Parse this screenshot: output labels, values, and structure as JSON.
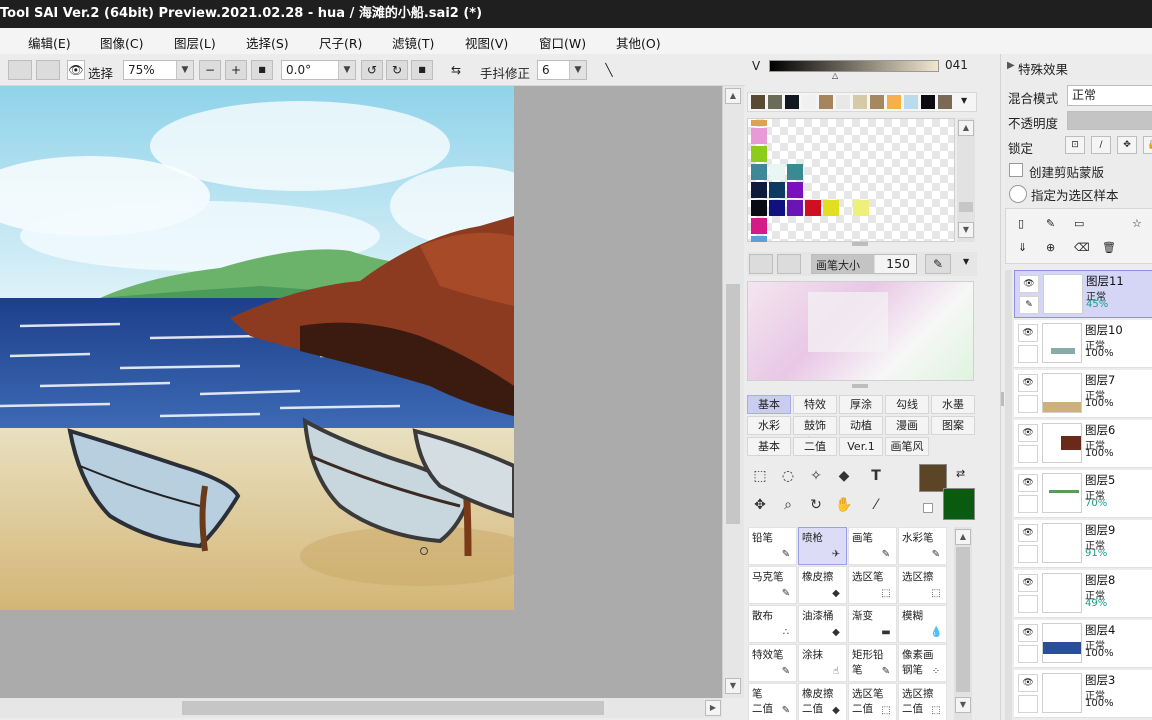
{
  "window": {
    "title": "Tool SAI Ver.2 (64bit) Preview.2021.02.28 - hua / 海滩的小船.sai2 (*)"
  },
  "menu": [
    "编辑(E)",
    "图像(C)",
    "图层(L)",
    "选择(S)",
    "尺子(R)",
    "滤镜(T)",
    "视图(V)",
    "窗口(W)",
    "其他(O)"
  ],
  "toolbar": {
    "select_label": "选择",
    "zoom_value": "75%",
    "minus": "−",
    "plus": "+",
    "reset": "■",
    "angle_value": "0.0°",
    "stabilizer_label": "手抖修正",
    "stabilizer_value": "6"
  },
  "color": {
    "v_label": "V",
    "v_value": "041",
    "palette_top": [
      "#5a4a32",
      "#6b6b5a",
      "#121820",
      "#f0f0f0",
      "#a6845c",
      "#e8e8e8",
      "#d6c9a8",
      "#a68860",
      "#f5b04a",
      "#b8dcea",
      "#0c0c10",
      "#7a6a55"
    ],
    "primary": "#5c4526",
    "secondary": "#0a5a10"
  },
  "brush": {
    "size_label": "画笔大小",
    "size_value": "150"
  },
  "tool_tabs": [
    [
      "基本",
      "特效",
      "厚涂",
      "勾线",
      "水墨"
    ],
    [
      "水彩",
      "鼓饰布...",
      "动植飞...",
      "漫画风...",
      "图案"
    ],
    [
      "基本",
      "二值",
      "Ver.1",
      "画笔风"
    ]
  ],
  "brushes": [
    {
      "name": "铅笔",
      "sub": ""
    },
    {
      "name": "喷枪",
      "sub": ""
    },
    {
      "name": "画笔",
      "sub": ""
    },
    {
      "name": "水彩笔",
      "sub": ""
    },
    {
      "name": "马克笔",
      "sub": ""
    },
    {
      "name": "橡皮擦",
      "sub": ""
    },
    {
      "name": "选区笔",
      "sub": ""
    },
    {
      "name": "选区擦",
      "sub": ""
    },
    {
      "name": "散布",
      "sub": ""
    },
    {
      "name": "油漆桶",
      "sub": ""
    },
    {
      "name": "渐变",
      "sub": ""
    },
    {
      "name": "模糊",
      "sub": ""
    },
    {
      "name": "特效笔",
      "sub": ""
    },
    {
      "name": "涂抹",
      "sub": ""
    },
    {
      "name": "矩形铅笔",
      "sub": ""
    },
    {
      "name": "像素画",
      "sub": "钢笔"
    },
    {
      "name": "笔",
      "sub": "二值"
    },
    {
      "name": "橡皮擦",
      "sub": "二值"
    },
    {
      "name": "选区笔",
      "sub": "二值"
    },
    {
      "name": "选区擦",
      "sub": "二值"
    }
  ],
  "layer_props": {
    "effects_label": "特殊效果",
    "blend_label": "混合模式",
    "blend_value": "正常",
    "opacity_label": "不透明度",
    "lock_label": "锁定",
    "clip_label": "创建剪贴蒙版",
    "sample_label": "指定为选区样本"
  },
  "layers": [
    {
      "name": "图层11",
      "mode": "正常",
      "opacity": "45%",
      "teal": true
    },
    {
      "name": "图层10",
      "mode": "正常",
      "opacity": "100%",
      "teal": false
    },
    {
      "name": "图层7",
      "mode": "正常",
      "opacity": "100%",
      "teal": false
    },
    {
      "name": "图层6",
      "mode": "正常",
      "opacity": "100%",
      "teal": false
    },
    {
      "name": "图层5",
      "mode": "正常",
      "opacity": "70%",
      "teal": true
    },
    {
      "name": "图层9",
      "mode": "正常",
      "opacity": "91%",
      "teal": true
    },
    {
      "name": "图层8",
      "mode": "正常",
      "opacity": "49%",
      "teal": true
    },
    {
      "name": "图层4",
      "mode": "正常",
      "opacity": "100%",
      "teal": false
    },
    {
      "name": "图层3",
      "mode": "正常",
      "opacity": "100%",
      "teal": false
    }
  ]
}
